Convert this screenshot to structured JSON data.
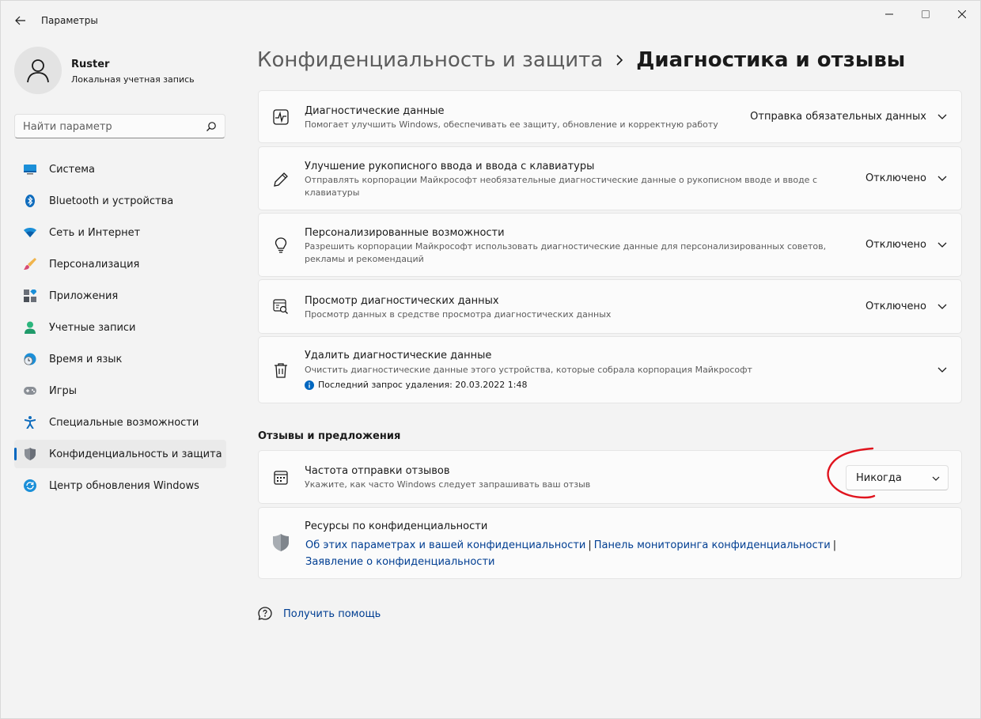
{
  "window": {
    "title": "Параметры"
  },
  "profile": {
    "name": "Ruster",
    "account_type": "Локальная учетная запись"
  },
  "search": {
    "placeholder": "Найти параметр"
  },
  "nav": {
    "items": [
      {
        "label": "Система",
        "icon": "display-icon"
      },
      {
        "label": "Bluetooth и устройства",
        "icon": "bluetooth-icon"
      },
      {
        "label": "Сеть и Интернет",
        "icon": "wifi-icon"
      },
      {
        "label": "Персонализация",
        "icon": "brush-icon"
      },
      {
        "label": "Приложения",
        "icon": "apps-icon"
      },
      {
        "label": "Учетные записи",
        "icon": "person-icon"
      },
      {
        "label": "Время и язык",
        "icon": "globe-clock-icon"
      },
      {
        "label": "Игры",
        "icon": "gamepad-icon"
      },
      {
        "label": "Специальные возможности",
        "icon": "accessibility-icon"
      },
      {
        "label": "Конфиденциальность и защита",
        "icon": "shield-icon"
      },
      {
        "label": "Центр обновления Windows",
        "icon": "update-icon"
      }
    ],
    "active_index": 9
  },
  "header": {
    "parent": "Конфиденциальность и защита",
    "current": "Диагностика и отзывы"
  },
  "cards": {
    "diagnostic_data": {
      "title": "Диагностические данные",
      "desc": "Помогает улучшить Windows, обеспечивать ее защиту, обновление и корректную работу",
      "value": "Отправка обязательных данных"
    },
    "handwriting": {
      "title": "Улучшение рукописного ввода и ввода с клавиатуры",
      "desc": "Отправлять корпорации Майкрософт необязательные диагностические данные о рукописном вводе и вводе с клавиатуры",
      "value": "Отключено"
    },
    "tailored": {
      "title": "Персонализированные возможности",
      "desc": "Разрешить корпорации Майкрософт использовать диагностические данные для персонализированных советов, рекламы и рекомендаций",
      "value": "Отключено"
    },
    "viewer": {
      "title": "Просмотр диагностических данных",
      "desc": "Просмотр данных в средстве просмотра диагностических данных",
      "value": "Отключено"
    },
    "delete": {
      "title": "Удалить диагностические данные",
      "desc": "Очистить диагностические данные этого устройства, которые собрала корпорация Майкрософт",
      "last_request": "Последний запрос удаления: 20.03.2022 1:48"
    }
  },
  "feedback": {
    "section_title": "Отзывы и предложения",
    "frequency_title": "Частота отправки отзывов",
    "frequency_desc": "Укажите, как часто Windows следует запрашивать ваш отзыв",
    "frequency_value": "Никогда"
  },
  "resources": {
    "title": "Ресурсы по конфиденциальности",
    "link1": "Об этих параметрах и вашей конфиденциальности",
    "link2": "Панель мониторинга конфиденциальности",
    "link3": "Заявление о конфиденциальности",
    "separator": "|"
  },
  "help": {
    "label": "Получить помощь"
  },
  "colors": {
    "accent": "#0067c0",
    "link": "#003e92",
    "annotation": "#e0141e"
  }
}
